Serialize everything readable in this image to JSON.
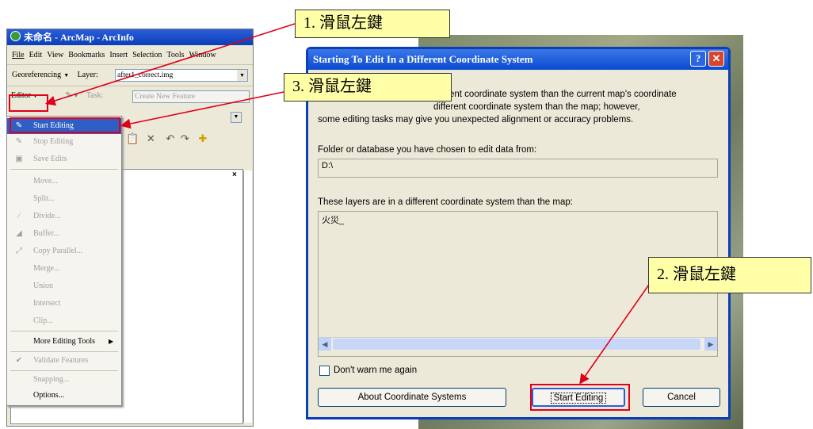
{
  "arcmap": {
    "title": "未命名 - ArcMap - ArcInfo",
    "menu": [
      "File",
      "Edit",
      "View",
      "Bookmarks",
      "Insert",
      "Selection",
      "Tools",
      "Window"
    ],
    "georef_label": "Georeferencing",
    "layer_label": "Layer:",
    "layer_value": "after1_correct.img",
    "editor_label": "Editor",
    "task_label": "Task:",
    "task_value": "Create New Feature"
  },
  "editor_menu": {
    "start_editing": "Start Editing",
    "stop_editing": "Stop Editing",
    "save_edits": "Save Edits",
    "move": "Move...",
    "split": "Split...",
    "divide": "Divide...",
    "buffer": "Buffer...",
    "copy_parallel": "Copy Parallel...",
    "merge": "Merge...",
    "union": "Union",
    "intersect": "Intersect",
    "clip": "Clip...",
    "more_tools": "More Editing Tools",
    "validate": "Validate Features",
    "snapping": "Snapping...",
    "options": "Options..."
  },
  "dialog": {
    "title": "Starting To Edit In a Different Coordinate System",
    "line1": "ent coordinate system than the current map's coordinate",
    "line2": "different coordinate system than the map; however,",
    "line3": "some editing tasks may give you unexpected alignment or accuracy problems.",
    "folder_label": "Folder or database you have chosen to edit data from:",
    "folder_value": "D:\\",
    "layers_label": "These layers are in a different coordinate system than the map:",
    "layer_item": "火災_",
    "dont_warn": "Don't warn me again",
    "about_button": "About Coordinate Systems",
    "start_button": "Start Editing",
    "cancel_button": "Cancel"
  },
  "callouts": {
    "c1": "1.  滑鼠左鍵",
    "c2": "2.  滑鼠左鍵",
    "c3": "3.  滑鼠左鍵"
  },
  "colors": {
    "highlight": "#e0001a",
    "callout_bg": "#ffffa8",
    "xp_blue": "#0b4ad0"
  }
}
